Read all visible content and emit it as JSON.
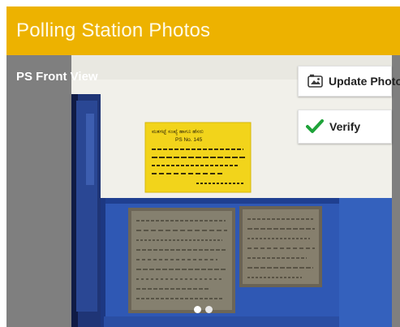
{
  "app_bar": {
    "title": "Polling Station Photos"
  },
  "photo_section": {
    "label": "PS Front View",
    "image": {
      "sign_text": "PS No. 145",
      "slides": 2,
      "active_slide": 1
    }
  },
  "actions": {
    "update_photo": {
      "label": "Update Photo",
      "icon": "photo-camera-icon"
    },
    "verify": {
      "label": "Verify",
      "icon": "check-icon"
    }
  },
  "colors": {
    "app_bar": "#edb200",
    "content_bg": "#7f7f7f",
    "check": "#1fa33a",
    "wall_blue": "#2f58b4"
  }
}
